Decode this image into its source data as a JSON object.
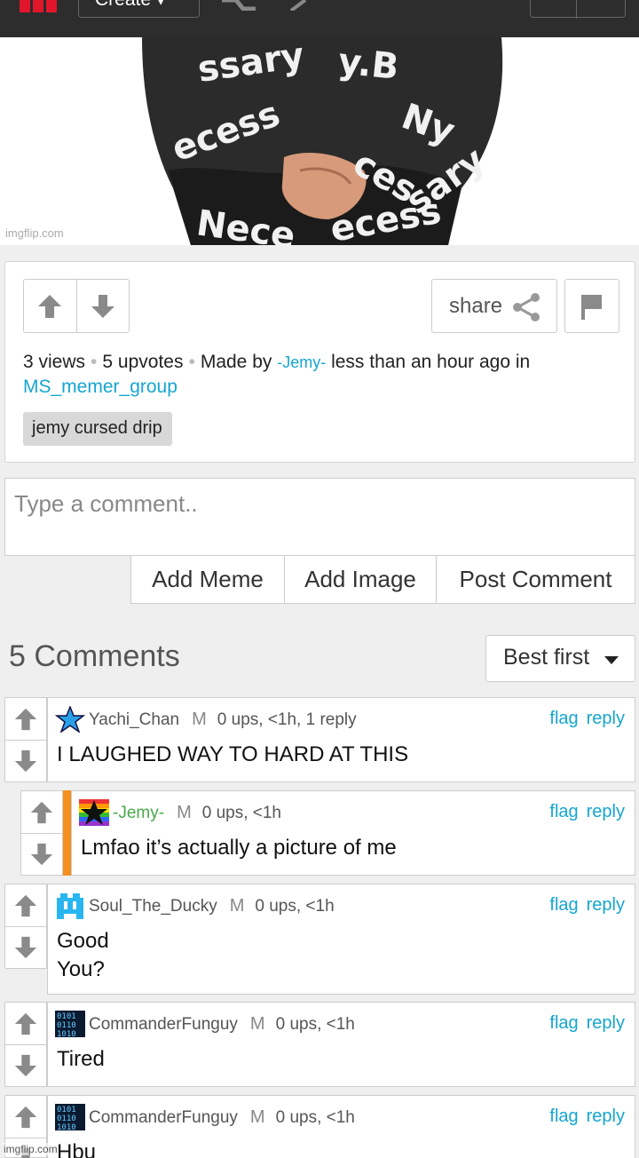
{
  "nav": {
    "create_label": "Create",
    "create_caret": "▾"
  },
  "meme": {
    "watermark": "imgflip.com",
    "jacket_words": [
      "ssary",
      "y.B",
      "Ny",
      "ecess",
      "ces",
      "Nece",
      "ecess",
      "sary"
    ]
  },
  "post": {
    "views": "3 views",
    "upvotes": "5 upvotes",
    "made_by": "Made by",
    "author": "-Jemy-",
    "time_in": "less than an hour ago in",
    "stream": "MS_memer_group",
    "tag": "jemy cursed drip",
    "share_label": "share",
    "separator": "•"
  },
  "composer": {
    "placeholder": "Type a comment..",
    "add_meme": "Add Meme",
    "add_image": "Add Image",
    "post_comment": "Post Comment"
  },
  "comments_header": {
    "count_label": "5 Comments",
    "sort_label": "Best first"
  },
  "comments": [
    {
      "user": "Yachi_Chan",
      "mod": "M",
      "meta": "0 ups, <1h, 1 reply",
      "text": "I LAUGHED WAY TO HARD AT THIS",
      "user_color": "#555555",
      "avatar": "star-blue"
    },
    {
      "user": "-Jemy-",
      "mod": "M",
      "meta": "0 ups, <1h",
      "text": "Lmfao it’s actually a picture of me",
      "user_color": "#4aa84a",
      "avatar": "star-rainbow"
    },
    {
      "user": "Soul_The_Ducky",
      "mod": "M",
      "meta": "0 ups, <1h",
      "text": "Good\nYou?",
      "user_color": "#555555",
      "avatar": "pixel-ghost"
    },
    {
      "user": "CommanderFunguy",
      "mod": "M",
      "meta": "0 ups, <1h",
      "text": "Tired",
      "user_color": "#555555",
      "avatar": "binary"
    },
    {
      "user": "CommanderFunguy",
      "mod": "M",
      "meta": "0 ups, <1h",
      "text": "Hbu",
      "user_color": "#555555",
      "avatar": "binary"
    }
  ],
  "comment_actions": {
    "flag": "flag",
    "reply": "reply"
  },
  "avatar_text": {
    "binary_row1": "0101",
    "binary_row2": "0110",
    "binary_row3": "1010"
  },
  "footer_watermark": "imgflip.com",
  "colors": {
    "link": "#15a6cf",
    "reply_stripe": "#f4911e",
    "topbar": "#2d2d2d",
    "brand_red": "#e2162b"
  }
}
